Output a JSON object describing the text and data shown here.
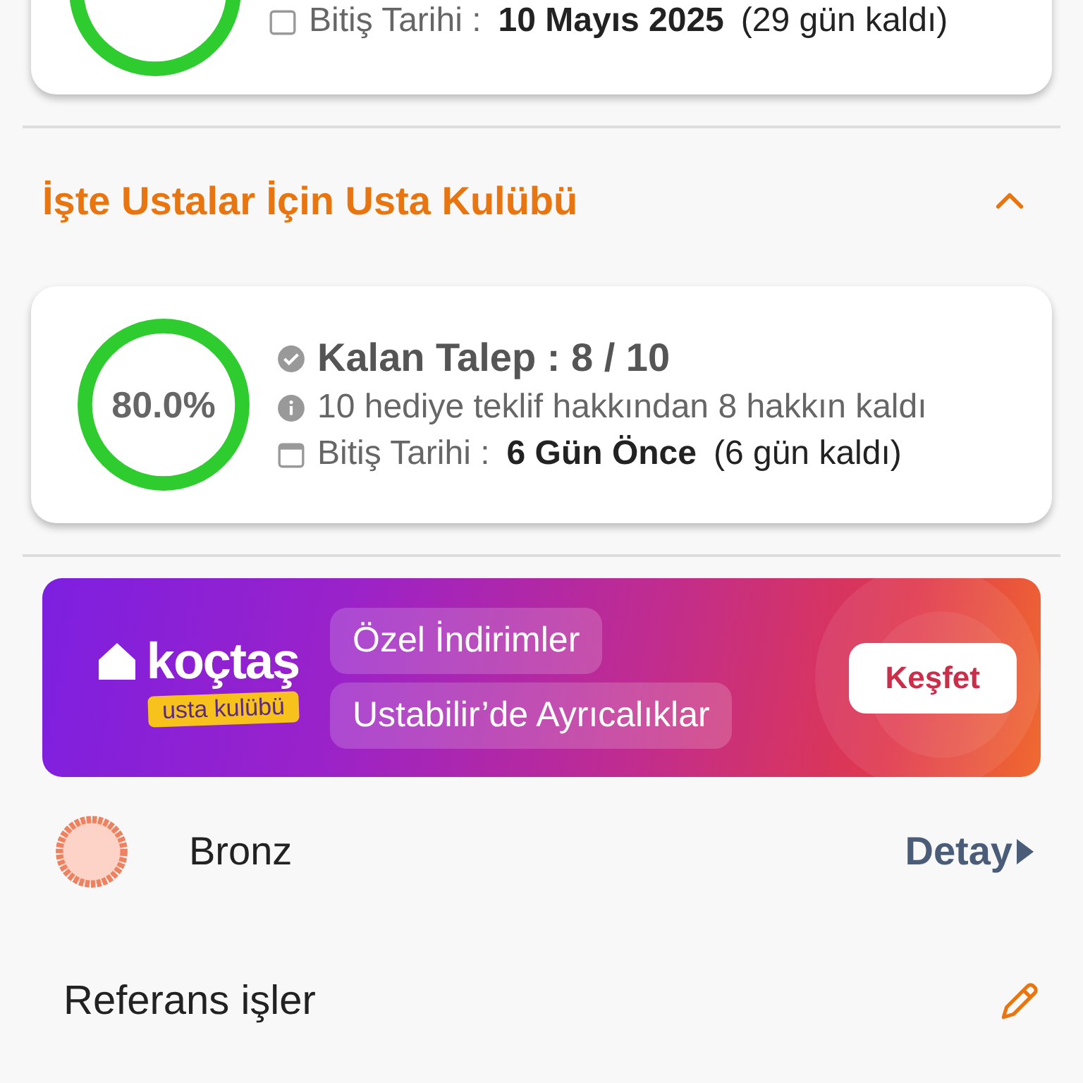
{
  "previous_card": {
    "date_label": "Bitiş Tarihi :",
    "date_value": "10 Mayıs 2025",
    "days_left": "(29 gün kaldı)"
  },
  "section": {
    "title": "İşte Ustalar İçin Usta Kulübü",
    "expanded": true
  },
  "card": {
    "percent": "80.0%",
    "title": "Kalan Talep : 8 / 10",
    "info": "10 hediye teklif hakkından 8 hakkın kaldı",
    "date_label": "Bitiş Tarihi :",
    "date_value": "6 Gün Önce",
    "days_left": "(6 gün kaldı)"
  },
  "banner": {
    "brand": "koçtaş",
    "brand_sub": "usta kulübü",
    "chips": [
      "Özel İndirimler",
      "Ustabilir’de Ayrıcalıklar"
    ],
    "button": "Keşfet"
  },
  "level_row": {
    "label": "Bronz",
    "link": "Detay"
  },
  "references": {
    "label": "Referans işler"
  }
}
